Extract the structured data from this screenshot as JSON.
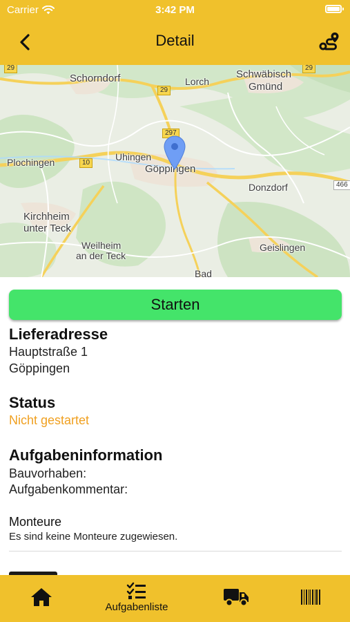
{
  "statusbar": {
    "carrier": "Carrier",
    "time": "3:42 PM"
  },
  "nav": {
    "title": "Detail",
    "back_icon": "chevron-left-icon",
    "route_icon": "route-icon"
  },
  "map": {
    "labels": {
      "schorndorf": "Schorndorf",
      "lorch": "Lorch",
      "schwaebisch": "Schwäbisch",
      "gmuend": "Gmünd",
      "uhingen": "Uhingen",
      "plochingen": "Plochingen",
      "goeppingen": "Göppingen",
      "donzdorf": "Donzdorf",
      "kirchheim": "Kirchheim",
      "unter_teck": "unter Teck",
      "weilheim": "Weilheim",
      "an_der_teck": "an der Teck",
      "geislingen": "Geislingen",
      "bad": "Bad"
    },
    "roads": {
      "r29a": "29",
      "r29b": "29",
      "r29c": "29",
      "r297": "297",
      "r10": "10",
      "r466": "466"
    }
  },
  "detail": {
    "start_button": "Starten",
    "address_heading": "Lieferadresse",
    "address_street": "Hauptstraße 1",
    "address_city": "Göppingen",
    "status_heading": "Status",
    "status_value": "Nicht gestartet",
    "task_heading": "Aufgabeninformation",
    "task_project": "Bauvorhaben:",
    "task_comment": "Aufgabenkommentar:",
    "fitters_heading": "Monteure",
    "fitters_text": "Es sind keine Monteure zugewiesen."
  },
  "tabbar": {
    "home_icon": "home-icon",
    "tasks_icon": "checklist-icon",
    "tasks_label": "Aufgabenliste",
    "truck_icon": "truck-icon",
    "barcode_icon": "barcode-icon"
  },
  "colors": {
    "accent": "#f0c12c",
    "start_button": "#44e46a",
    "status_pending": "#f0a020",
    "map_pin": "#6f9ef5"
  }
}
